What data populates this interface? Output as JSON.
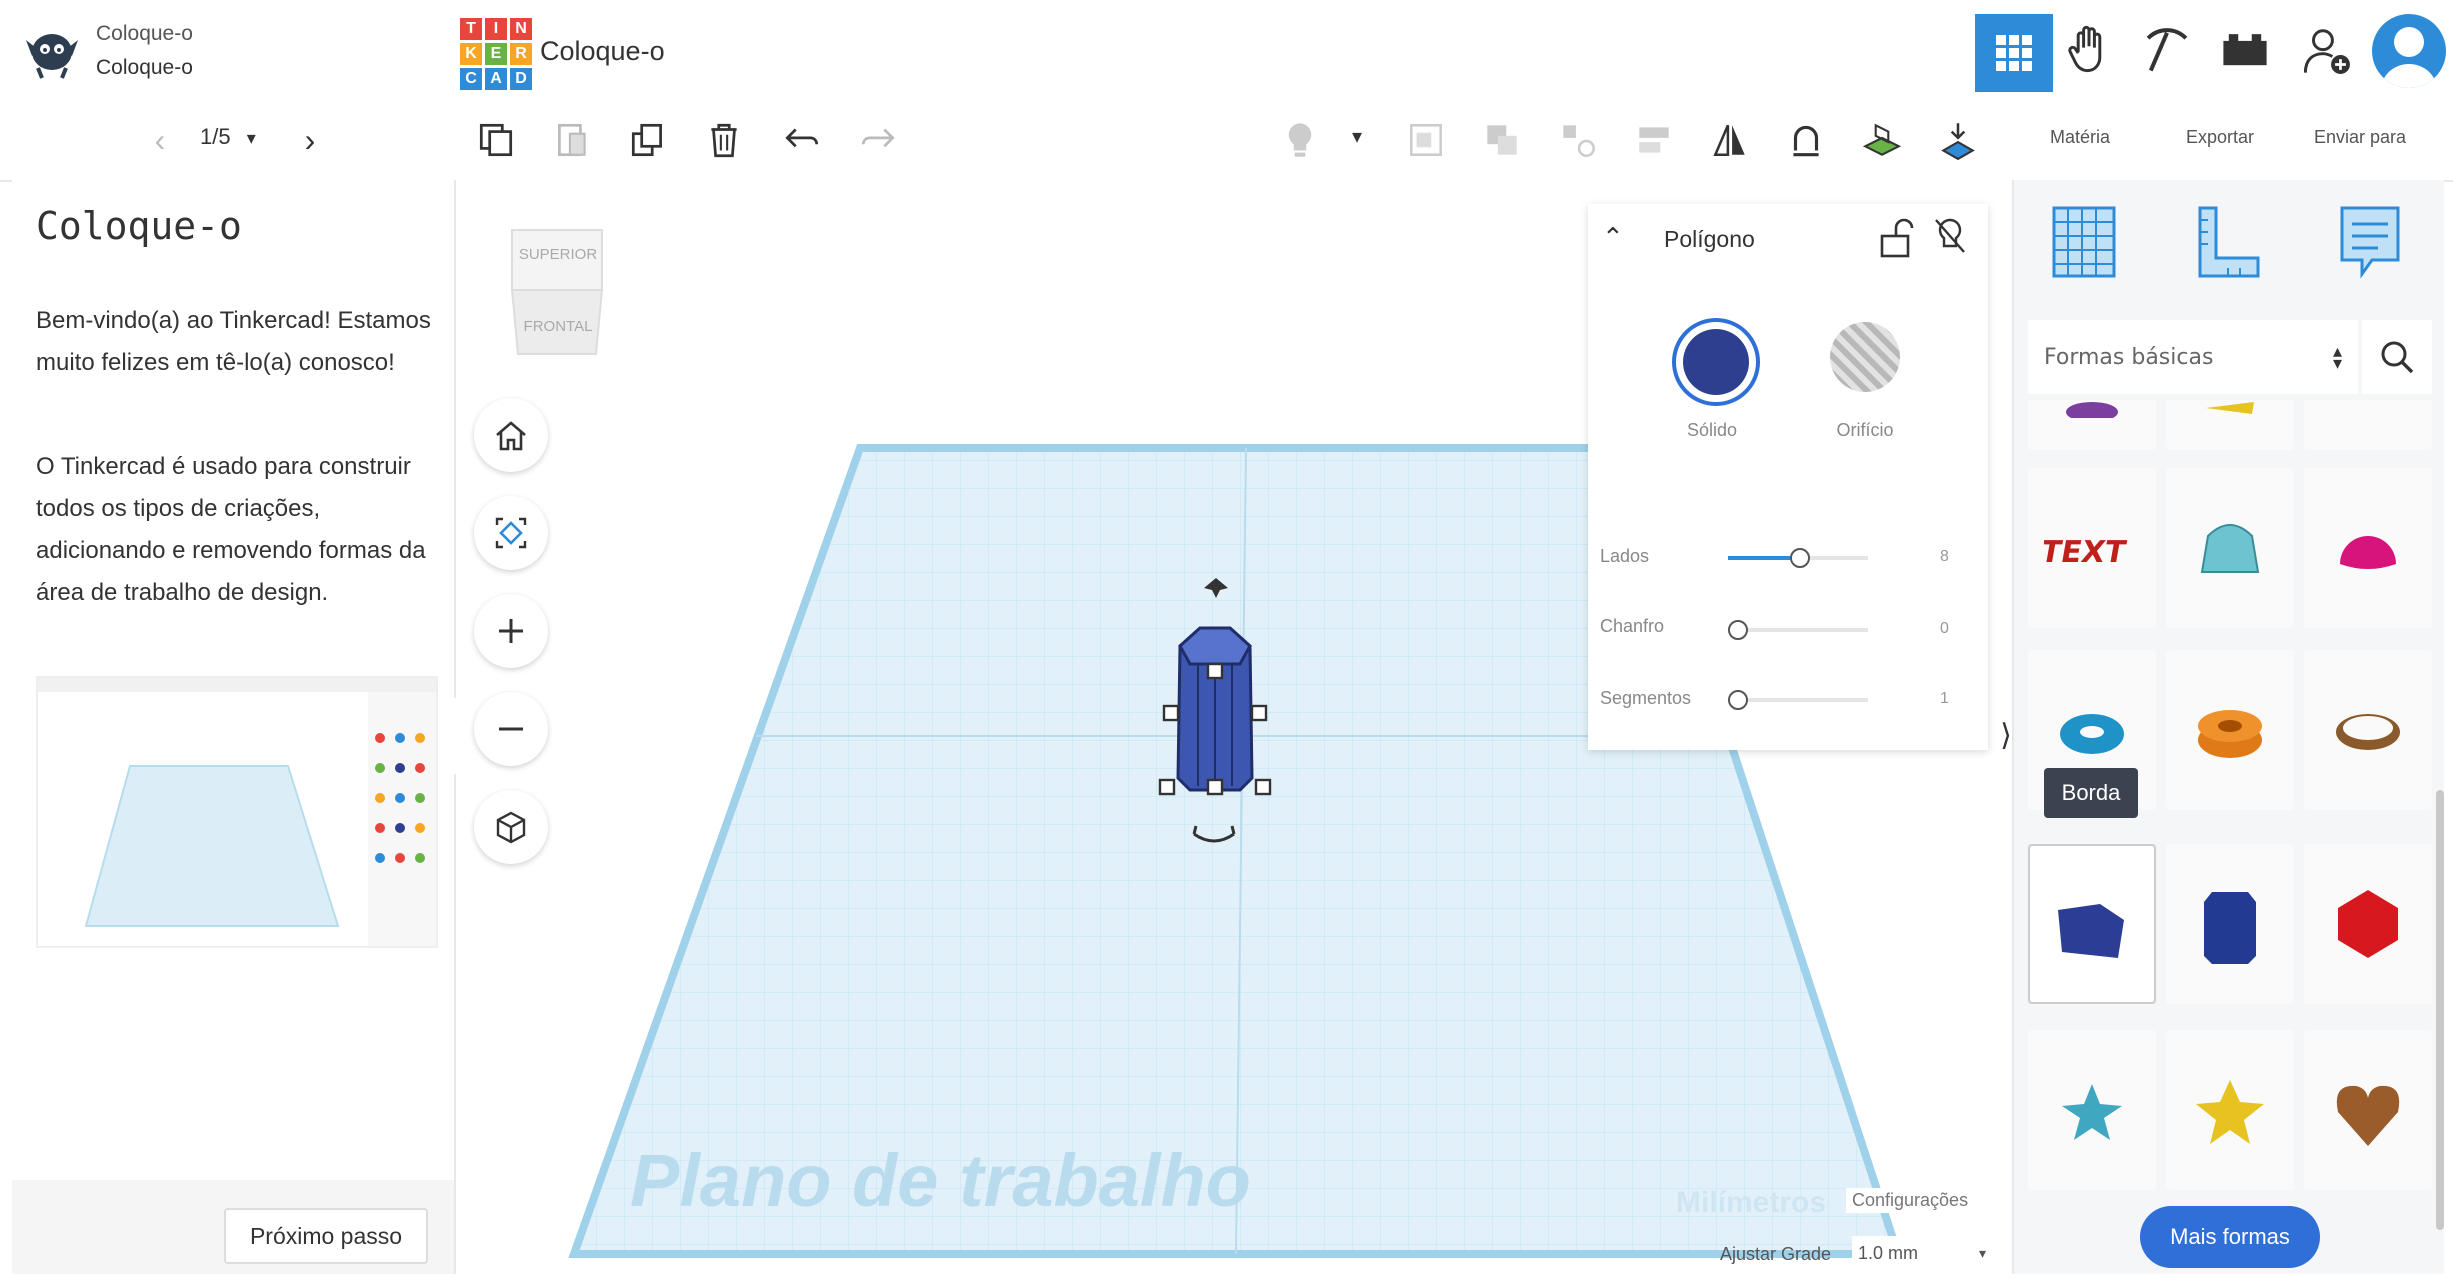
{
  "header": {
    "user_line1": "Coloque-o",
    "user_line2": "Coloque-o",
    "logo_letters": [
      "T",
      "I",
      "N",
      "K",
      "E",
      "R",
      "C",
      "A",
      "D"
    ],
    "design_title": "Coloque-o"
  },
  "lesson_nav": {
    "page": "1/5"
  },
  "right_tabs": {
    "import": "Matéria",
    "export": "Exportar",
    "send_to": "Enviar para"
  },
  "lesson": {
    "title": "Coloque-o",
    "paragraph1": "Bem-vindo(a) ao Tinkercad! Estamos muito felizes em tê-lo(a) conosco!",
    "paragraph2": "O Tinkercad é usado para construir todos os tipos de criações, adicionando e removendo formas da área de trabalho de design.",
    "next_button": "Próximo passo"
  },
  "viewcube": {
    "top": "SUPERIOR",
    "front": "FRONTAL"
  },
  "workplane": {
    "label": "Plano de trabalho",
    "units": "Milímetros",
    "settings": "Configurações",
    "snap_label": "Ajustar Grade",
    "snap_value": "1.0 mm"
  },
  "inspector": {
    "title": "Polígono",
    "solid_label": "Sólido",
    "hole_label": "Orifício",
    "params": [
      {
        "label": "Lados",
        "value": "8",
        "level": 0.5
      },
      {
        "label": "Chanfro",
        "value": "0",
        "level": 0
      },
      {
        "label": "Segmentos",
        "value": "1",
        "level": 0
      }
    ]
  },
  "shapes": {
    "category": "Formas básicas",
    "tooltip": "Borda",
    "more_button": "Mais formas"
  },
  "colors": {
    "accent": "#2e6fd8",
    "shape_blue": "#2f3f8f",
    "grid_light": "#d8ecf7",
    "grid_line": "#9ccfe8",
    "workplane_text": "#b9dbee"
  }
}
